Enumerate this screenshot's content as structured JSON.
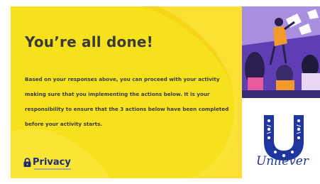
{
  "slide": {
    "title": "You’re all done!",
    "body": "Based on your responses above, you can proceed with your activity making sure that you implementing the actions below. It is your responsibility to ensure that the 3 actions below have been completed before your activity starts.",
    "privacy_logo_text": "Privacy",
    "brand_name": "Unilever"
  },
  "colors": {
    "panel_yellow": "#f7e11d",
    "title_text": "#3a3a3a",
    "privacy_blue": "#1f2a7a",
    "unilever_blue": "#1f36a0"
  },
  "icons": {
    "privacy": "lock-icon",
    "illustration": "classroom-illustration",
    "brand": "unilever-u-logo"
  }
}
